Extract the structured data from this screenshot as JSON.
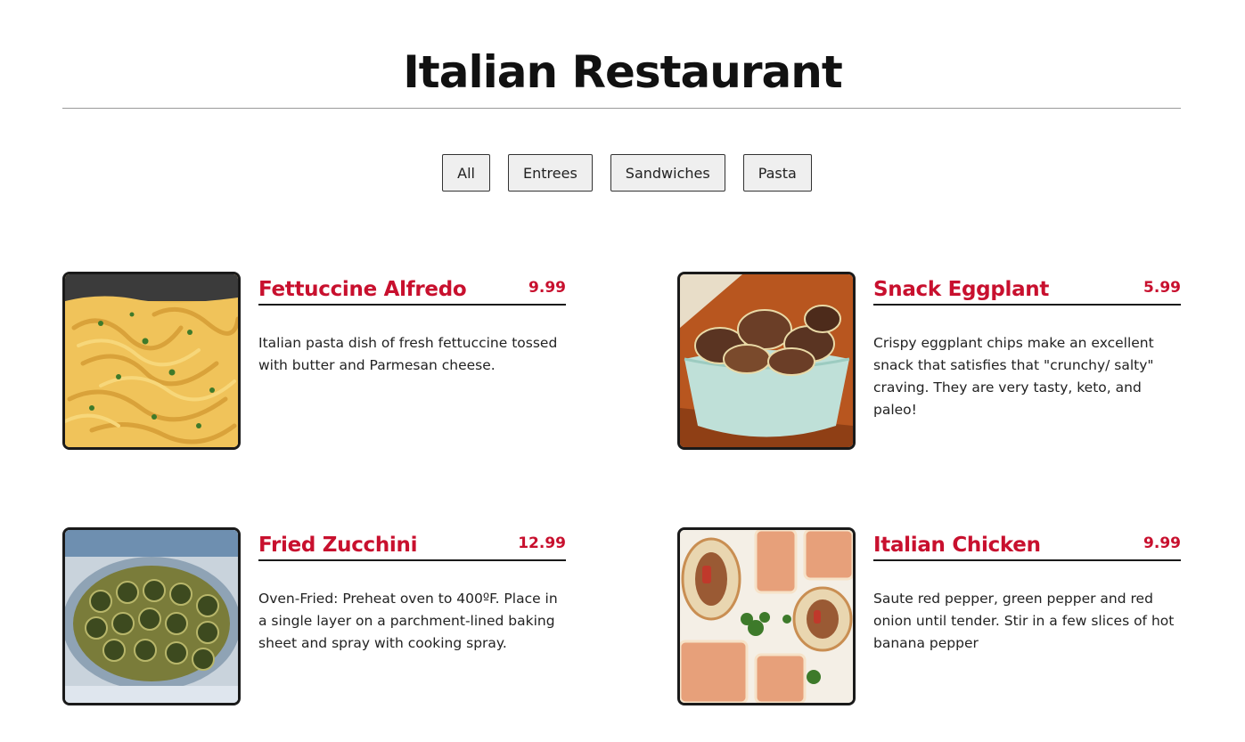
{
  "page": {
    "title": "Italian Restaurant"
  },
  "filters": [
    {
      "label": "All"
    },
    {
      "label": "Entrees"
    },
    {
      "label": "Sandwiches"
    },
    {
      "label": "Pasta"
    }
  ],
  "menu": [
    {
      "name": "Fettuccine Alfredo",
      "price": "9.99",
      "description": "Italian pasta dish of fresh fettuccine tossed with butter and Parmesan cheese.",
      "image": "fettuccine-alfredo-photo"
    },
    {
      "name": "Snack Eggplant",
      "price": "5.99",
      "description": "Crispy eggplant chips make an excellent snack that satisfies that \"crunchy/ salty\" craving. They are very tasty, keto, and paleo!",
      "image": "eggplant-chips-photo"
    },
    {
      "name": "Fried Zucchini",
      "price": "12.99",
      "description": "Oven-Fried: Preheat oven to 400ºF. Place in a single layer on a parchment-lined baking sheet and spray with cooking spray.",
      "image": "fried-zucchini-photo"
    },
    {
      "name": "Italian Chicken",
      "price": "9.99",
      "description": "Saute red pepper, green pepper and red onion until tender. Stir in a few slices of hot banana pepper",
      "image": "italian-chicken-sandwich-photo"
    }
  ],
  "colors": {
    "accent": "#c8102e",
    "text": "#111111",
    "button_bg": "#efefef"
  }
}
